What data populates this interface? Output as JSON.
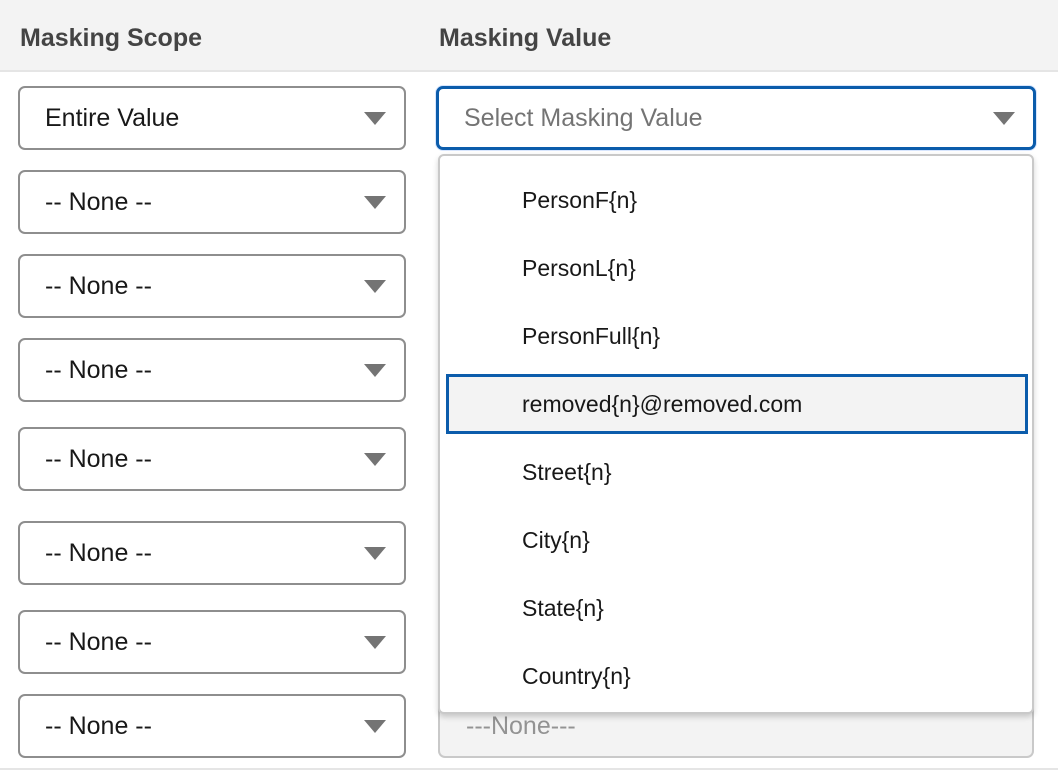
{
  "table": {
    "headers": {
      "scope": "Masking Scope",
      "value": "Masking Value"
    },
    "scope_rows": [
      "Entire Value",
      "-- None --",
      "-- None --",
      "-- None --",
      "-- None --",
      "-- None --",
      "-- None --",
      "-- None --"
    ],
    "value_select": {
      "placeholder": "Select Masking Value"
    },
    "dropdown": {
      "options": [
        "PersonF{n}",
        "PersonL{n}",
        "PersonFull{n}",
        "removed{n}@removed.com",
        "Street{n}",
        "City{n}",
        "State{n}",
        "Country{n}"
      ],
      "highlighted_index": 3
    },
    "disabled_value": "---None---"
  },
  "colors": {
    "focus_border": "#0b5cab",
    "header_bg": "#f3f3f3",
    "caret": "#747474"
  },
  "icons": {
    "select_caret": "caret-down-icon"
  }
}
